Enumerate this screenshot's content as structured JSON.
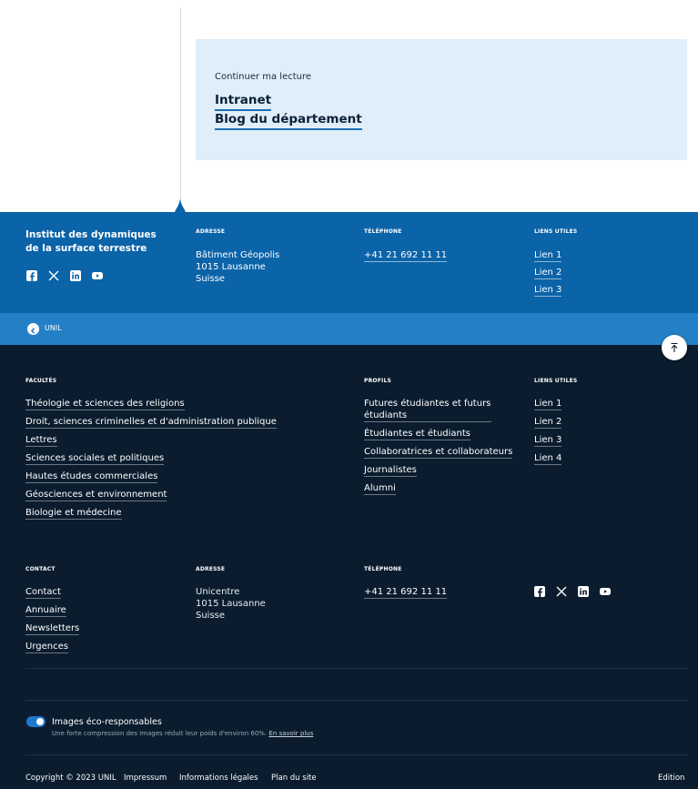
{
  "reading": {
    "title": "Continuer ma lecture",
    "links": [
      "Intranet",
      "Blog du département"
    ]
  },
  "institute": {
    "name": "Institut des dynamiques de la surface terrestre",
    "address_heading": "ADRESSE",
    "address_lines": [
      "Bâtiment Géopolis",
      "1015 Lausanne",
      "Suisse"
    ],
    "phone_heading": "TÉLÉPHONE",
    "phone": "+41 21 692 11 11",
    "links_heading": "LIENS UTILES",
    "links": [
      "Lien 1",
      "Lien 2",
      "Lien 3"
    ],
    "socials": [
      "facebook-icon",
      "x-icon",
      "linkedin-icon",
      "youtube-icon"
    ]
  },
  "unil_bar": {
    "label": "UNIL",
    "back_icon": "chevron-left-icon",
    "scroll_top_icon": "arrow-up-icon"
  },
  "footer": {
    "faculties_heading": "FACULTÉS",
    "faculties": [
      "Théologie et sciences des religions",
      "Droit, sciences criminelles et d'administration publique",
      "Lettres",
      "Sciences sociales et politiques",
      "Hautes études commerciales",
      "Géosciences et environnement",
      "Biologie et médecine"
    ],
    "profiles_heading": "PROFILS",
    "profiles": [
      "Futures étudiantes et futurs étudiants",
      "Étudiantes et étudiants",
      "Collaboratrices et collaborateurs",
      "Journalistes",
      "Alumni"
    ],
    "links_heading": "LIENS UTILES",
    "links": [
      "Lien 1",
      "Lien 2",
      "Lien 3",
      "Lien 4"
    ],
    "contact_heading": "CONTACT",
    "contact": [
      "Contact",
      "Annuaire",
      "Newsletters",
      "Urgences"
    ],
    "address_heading": "ADRESSE",
    "address_lines": [
      "Unicentre",
      "1015 Lausanne",
      "Suisse"
    ],
    "phone_heading": "TÉLÉPHONE",
    "phone": "+41 21 692 11 11",
    "eco": {
      "title": "Images éco-responsables",
      "desc": "Une forte compression des images réduit leur poids d'environ 60%.",
      "more": "En savoir plus",
      "enabled": true
    },
    "bottom": {
      "copyright": "Copyright © 2023 UNIL",
      "impressum": "Impressum",
      "legal": "Informations légales",
      "sitemap": "Plan du site",
      "edition": "Edition"
    }
  },
  "colors": {
    "reading_bg": "#dfeef8",
    "institute_bg": "#0b63a8",
    "unil_bar_bg": "#2480c6",
    "footer_bg": "#0a1c2e",
    "accent": "#1a70b8"
  }
}
